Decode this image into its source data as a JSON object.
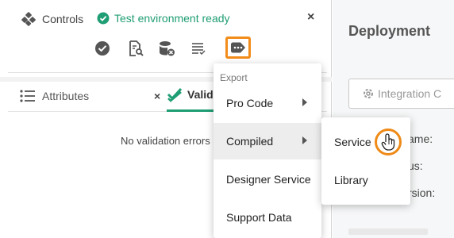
{
  "controls": {
    "label": "Controls",
    "status_text": "Test environment ready",
    "close_symbol": "×",
    "toolbar": [
      {
        "icon": "check-circle-icon"
      },
      {
        "icon": "document-search-icon"
      },
      {
        "icon": "database-delete-icon"
      },
      {
        "icon": "list-icon"
      },
      {
        "icon": "export-tag-icon",
        "active": true
      }
    ]
  },
  "tabs": {
    "attributes_label": "Attributes",
    "close_symbol": "×",
    "validation_label": "Validation"
  },
  "validation": {
    "message": "No validation errors"
  },
  "deployment": {
    "title": "Deployment",
    "integration_label": "Integration C",
    "partial_labels": [
      "ame:",
      "us:",
      "rsion:"
    ]
  },
  "menu": {
    "header": "Export",
    "items": [
      {
        "label": "Pro Code",
        "has_submenu": true
      },
      {
        "label": "Compiled",
        "has_submenu": true,
        "hover": true
      },
      {
        "label": "Designer Service",
        "has_submenu": false
      },
      {
        "label": "Support Data",
        "has_submenu": false
      }
    ]
  },
  "submenu": {
    "items": [
      {
        "label": "Service"
      },
      {
        "label": "Library"
      }
    ]
  },
  "colors": {
    "accent_green": "#1f9d74",
    "highlight_orange": "#f28c1a"
  }
}
